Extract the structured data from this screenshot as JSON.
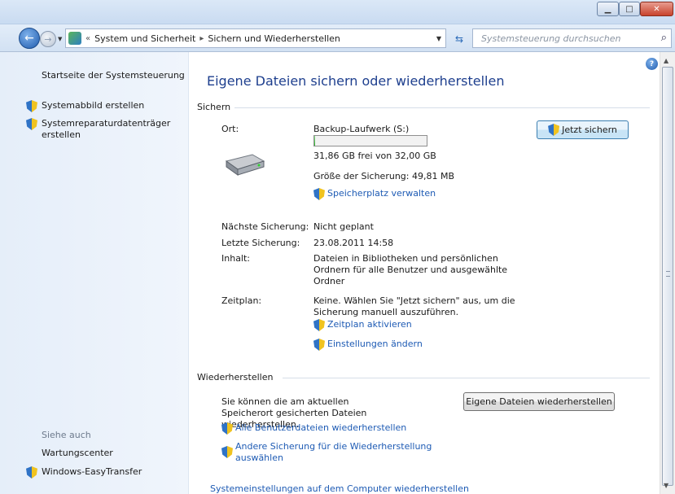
{
  "window": {
    "minimize_icon": "minimize-icon",
    "maximize_icon": "maximize-icon",
    "close_icon": "close-icon"
  },
  "nav": {
    "back_icon": "back-arrow-icon",
    "forward_icon": "forward-arrow-icon",
    "overflow": "«",
    "breadcrumbs": [
      "System und Sicherheit",
      "Sichern und Wiederherstellen"
    ],
    "search_placeholder": "Systemsteuerung durchsuchen"
  },
  "sidebar": {
    "home": "Startseite der Systemsteuerung",
    "tasks": [
      {
        "label": "Systemabbild erstellen",
        "icon": "shield-icon"
      },
      {
        "label": "Systemreparaturdatenträger erstellen",
        "icon": "shield-icon"
      }
    ],
    "see_also_heading": "Siehe auch",
    "see_also": [
      {
        "label": "Wartungscenter",
        "icon": ""
      },
      {
        "label": "Windows-EasyTransfer",
        "icon": "shield-icon"
      }
    ]
  },
  "main": {
    "title": "Eigene Dateien sichern oder wiederherstellen",
    "backup": {
      "heading": "Sichern",
      "location_label": "Ort:",
      "location_value": "Backup-Laufwerk (S:)",
      "free_space": "31,86 GB frei von 32,00 GB",
      "free_fraction": 0.004,
      "backup_size": "Größe der Sicherung: 49,81 MB",
      "manage_space_link": "Speicherplatz verwalten",
      "backup_now_button": "Jetzt sichern",
      "details": [
        {
          "label": "Nächste Sicherung:",
          "value": "Nicht geplant"
        },
        {
          "label": "Letzte Sicherung:",
          "value": "23.08.2011 14:58"
        },
        {
          "label": "Inhalt:",
          "value": "Dateien in Bibliotheken und persönlichen Ordnern für alle Benutzer und ausgewählte Ordner"
        },
        {
          "label": "Zeitplan:",
          "value": "Keine. Wählen Sie \"Jetzt sichern\" aus, um die Sicherung manuell auszuführen."
        }
      ],
      "enable_schedule_link": "Zeitplan aktivieren",
      "change_settings_link": "Einstellungen ändern"
    },
    "restore": {
      "heading": "Wiederherstellen",
      "description": "Sie können die am aktuellen Speicherort gesicherten Dateien wiederherstellen.",
      "restore_button": "Eigene Dateien wiederherstellen",
      "restore_all_link": "Alle Benutzerdateien wiederherstellen",
      "other_backup_link": "Andere Sicherung für die Wiederherstellung auswählen",
      "system_restore_link": "Systemeinstellungen auf dem Computer wiederherstellen"
    }
  },
  "colors": {
    "link": "#1e5bb4",
    "title": "#1e3f8e",
    "sidebar_bg": "#e5eef9"
  }
}
